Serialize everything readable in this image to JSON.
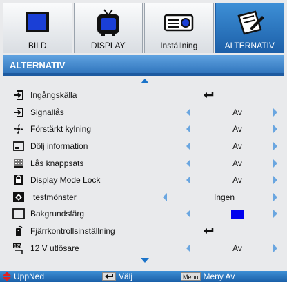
{
  "tabs": [
    {
      "label": "BILD",
      "icon": "picture-icon"
    },
    {
      "label": "DISPLAY",
      "icon": "display-tv-icon"
    },
    {
      "label": "Inställning",
      "icon": "projector-icon"
    },
    {
      "label": "ALTERNATIV",
      "icon": "options-pen-icon"
    }
  ],
  "active_tab": "ALTERNATIV",
  "section_title": "ALTERNATIV",
  "rows": [
    {
      "label": "Ingångskälla",
      "icon": "input-source-icon",
      "value": "",
      "kind": "enter"
    },
    {
      "label": "Signallås",
      "icon": "signal-lock-icon",
      "value": "Av",
      "kind": "select"
    },
    {
      "label": "Förstärkt kylning",
      "icon": "fan-icon",
      "value": "Av",
      "kind": "select"
    },
    {
      "label": "Dölj information",
      "icon": "hide-info-icon",
      "value": "Av",
      "kind": "select"
    },
    {
      "label": "Lås knappsats",
      "icon": "keypad-lock-icon",
      "value": "Av",
      "kind": "select"
    },
    {
      "label": "Display Mode Lock",
      "icon": "display-mode-lock-icon",
      "value": "Av",
      "kind": "select"
    },
    {
      "label": "testmönster",
      "icon": "test-pattern-icon",
      "value": "Ingen",
      "kind": "select"
    },
    {
      "label": "Bakgrundsfärg",
      "icon": "background-color-icon",
      "value": "",
      "kind": "color"
    },
    {
      "label": "Fjärrkontrollsinställning",
      "icon": "remote-settings-icon",
      "value": "",
      "kind": "enter"
    },
    {
      "label": "12 V utlösare",
      "icon": "12v-trigger-icon",
      "value": "Av",
      "kind": "select"
    }
  ],
  "background_color": "#0000ee",
  "accent_color": "#1a73c9",
  "bottom_bar": {
    "updown_label": "UppNed",
    "select_label": "Välj",
    "menu_key": "Menu",
    "menu_label": "Meny Av"
  }
}
